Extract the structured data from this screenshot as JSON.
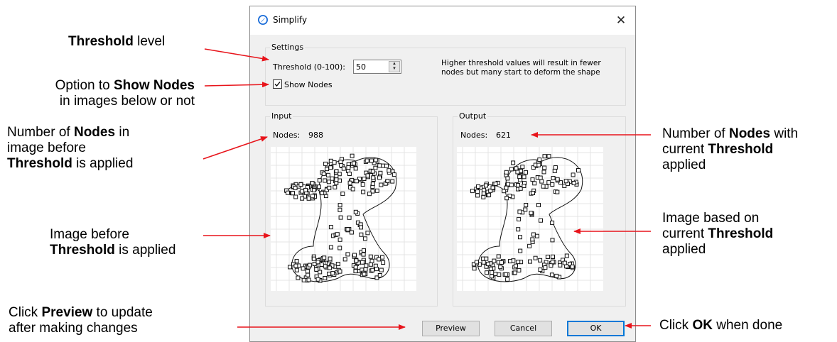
{
  "annotations": {
    "threshold": {
      "bold": "Threshold",
      "rest": " level"
    },
    "show_nodes": {
      "l1_pre": "Option to ",
      "l1_bold": "Show Nodes",
      "l2": "in images below or not"
    },
    "input_nodes": {
      "l1_pre": "Number of ",
      "l1_bold": "Nodes",
      "l1_post": " in",
      "l2": "image before",
      "l3_bold": "Threshold",
      "l3_post": " is applied"
    },
    "input_image": {
      "l1": "Image before",
      "l2_bold": "Threshold",
      "l2_post": " is applied"
    },
    "preview": {
      "l1_pre": "Click ",
      "l1_bold": "Preview",
      "l1_post": " to update",
      "l2": "after making changes"
    },
    "output_nodes": {
      "l1_pre": "Number of ",
      "l1_bold": "Nodes",
      "l1_post": " with",
      "l2_pre": "current ",
      "l2_bold": "Threshold",
      "l3": "applied"
    },
    "output_image": {
      "l1": "Image based on",
      "l2_pre": "current ",
      "l2_bold": "Threshold",
      "l3": "applied"
    },
    "ok": {
      "pre": "Click ",
      "bold": "OK",
      "post": " when done"
    }
  },
  "dialog": {
    "title": "Simplify",
    "close_glyph": "✕",
    "settings": {
      "group_label": "Settings",
      "threshold_label": "Threshold (0-100):",
      "threshold_value": "50",
      "show_nodes_label": "Show Nodes",
      "show_nodes_checked": true,
      "hint_line1": "Higher threshold values will result in fewer",
      "hint_line2": "nodes but many start to deform the shape"
    },
    "input": {
      "group_label": "Input",
      "nodes_label": "Nodes:",
      "nodes_value": "988"
    },
    "output": {
      "group_label": "Output",
      "nodes_label": "Nodes:",
      "nodes_value": "621"
    },
    "buttons": {
      "preview": "Preview",
      "cancel": "Cancel",
      "ok": "OK"
    }
  },
  "colors": {
    "arrow": "#e8141b",
    "default_button_border": "#0078d7",
    "app_icon": "#1e6fd9"
  },
  "icons": {
    "app": "compass-icon",
    "close": "close-icon",
    "spin": "spinner-arrows-icon",
    "check": "checkmark-icon"
  }
}
